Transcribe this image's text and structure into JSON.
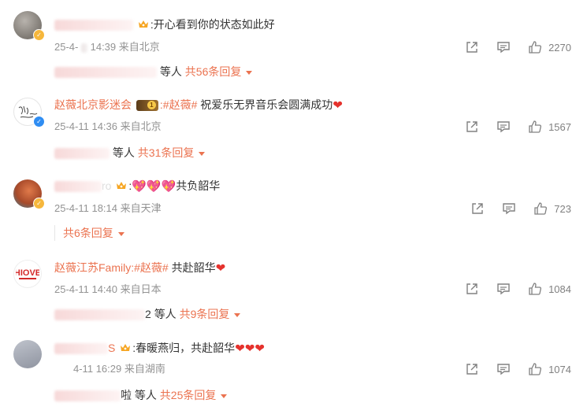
{
  "comments": [
    {
      "text": ":开心看到你的状态如此好",
      "date": "25-4-",
      "date_tail": "14:39",
      "location": "来自北京",
      "likes": "2270",
      "replies_suffix": "等人",
      "replies_link": "共56条回复"
    },
    {
      "username": "赵薇北京影迷会",
      "topic": ":#赵薇#",
      "text": " 祝爱乐无界音乐会圆满成功",
      "date": "25-4-11",
      "date_tail": "14:36",
      "location": "来自北京",
      "likes": "1567",
      "replies_suffix": "等人",
      "replies_link": "共31条回复"
    },
    {
      "name_tail": "ro",
      "text": "共负韶华",
      "date": "25-4-11",
      "date_tail": "18:14",
      "location": "来自天津",
      "likes": "723",
      "replies_link": "共6条回复"
    },
    {
      "username": "赵薇江苏Family",
      "topic": ":#赵薇#",
      "text": " 共赴韶华",
      "date": "25-4-11",
      "date_tail": "14:40",
      "location": "来自日本",
      "likes": "1084",
      "replies_prefix": "2",
      "replies_suffix": "等人",
      "replies_link": "共9条回复"
    },
    {
      "name_tail": "S",
      "text": ":春暖燕归，共赴韶华",
      "date": "4-11",
      "date_tail": "16:29",
      "location": "来自湖南",
      "likes": "1074",
      "replies_prefix": "啦",
      "replies_suffix": "等人",
      "replies_link": "共25条回复"
    }
  ],
  "colors": {
    "accent": "#eb7350",
    "meta": "#939393",
    "heart": "#e5322d"
  }
}
